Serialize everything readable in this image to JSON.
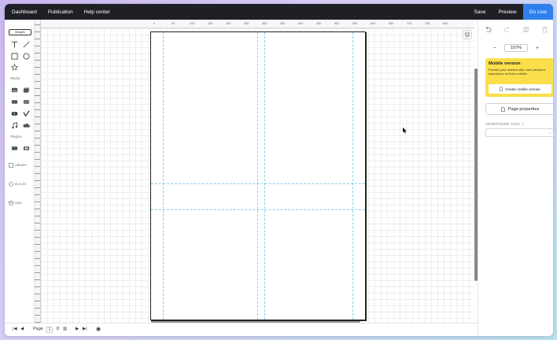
{
  "topbar": {
    "nav": [
      "Dashboard",
      "Publication",
      "Help center"
    ],
    "save_label": "Save",
    "preview_label": "Preview",
    "golive_label": "Go Live"
  },
  "lefttools": {
    "widgets_label": "Widgets",
    "media_label": "Media",
    "plugins_label": "Plugins",
    "library_label": "LIBRARY",
    "blocks_label": "BLOCKS",
    "data_label": "DATA"
  },
  "ruler": {
    "ticks": [
      "0",
      "50",
      "100",
      "150",
      "200",
      "250",
      "300",
      "350",
      "400",
      "450",
      "500",
      "550",
      "600",
      "650",
      "700",
      "750",
      "800"
    ]
  },
  "rightpanel": {
    "zoom_minus": "−",
    "zoom_value": "107%",
    "zoom_plus": "+",
    "mobile_title": "Mobile version",
    "mobile_desc": "Provide your readers with more pleasant experience on their mobiles",
    "mobile_button": "Create mobile version",
    "page_properties": "Page properties",
    "ad_tags_label": "ADVERTISING TAGS"
  },
  "bottombar": {
    "page_label": "Page",
    "page_number": "1",
    "page_count": "8"
  },
  "colors": {
    "topbar_bg": "#1f1f26",
    "accent": "#2f80ed",
    "mobile_card": "#fbdf4a",
    "guides": "#7fd0e8"
  }
}
